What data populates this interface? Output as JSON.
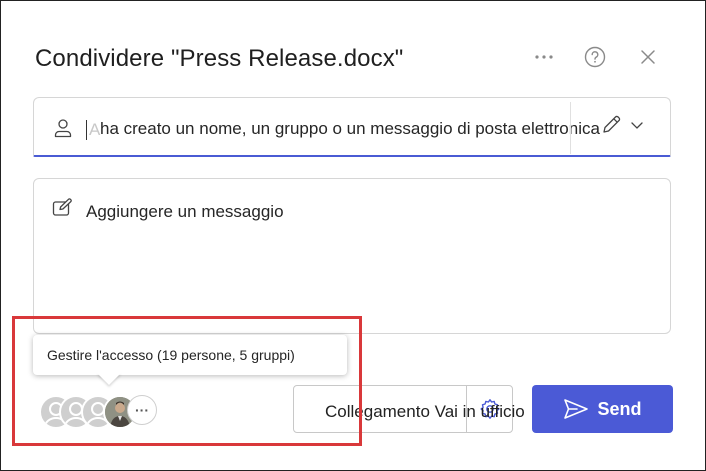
{
  "dialog": {
    "title": "Condividere \"Press Release.docx\"",
    "more_icon": "more-horizontal-icon",
    "help_icon": "help-icon",
    "close_icon": "close-icon"
  },
  "recipient": {
    "icon": "person-icon",
    "ghost_char": "A",
    "value": "ha creato un nome, un gruppo o un messaggio di posta elettronica",
    "edit_icon": "pencil-icon",
    "dropdown_icon": "chevron-down-icon"
  },
  "message": {
    "icon": "compose-icon",
    "placeholder": "Aggiungere un messaggio"
  },
  "access": {
    "tooltip": "Gestire l'accesso (19 persone, 5 gruppi)",
    "more_label": "···"
  },
  "link_settings": {
    "label": "Collegamento Vai in ufficio",
    "icon": "gear-icon"
  },
  "send": {
    "label": "Send",
    "icon": "send-icon",
    "color": "#4b5ad6"
  },
  "colors": {
    "accent": "#4a5bd4",
    "highlight": "#d9383a"
  }
}
